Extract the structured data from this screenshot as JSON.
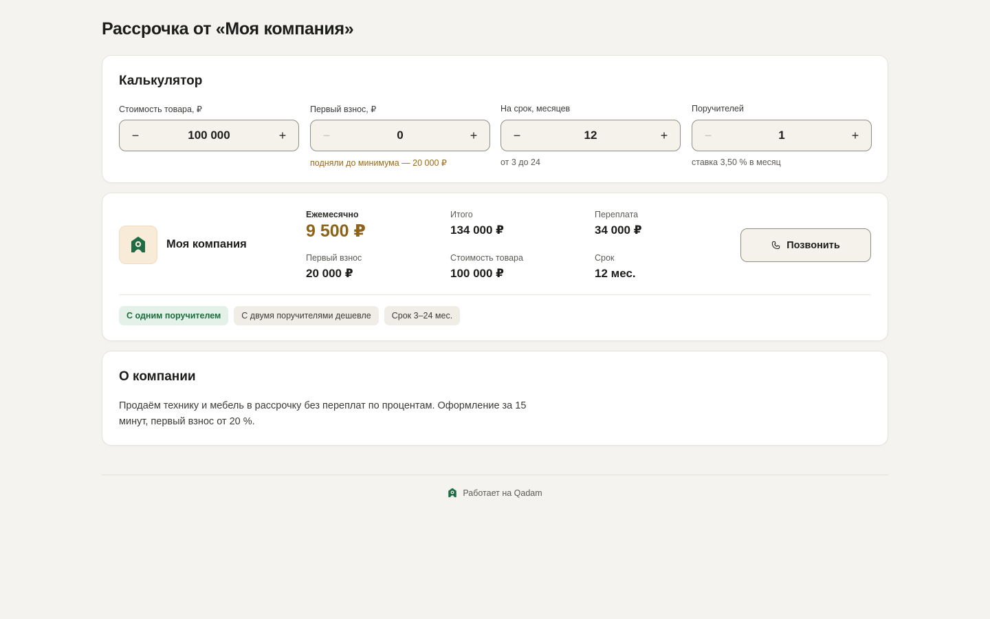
{
  "page": {
    "title": "Рассрочка от «Моя компания»"
  },
  "calculator": {
    "title": "Калькулятор",
    "fields": [
      {
        "label": "Стоимость товара, ₽",
        "value": "100 000",
        "hint": "",
        "minus_disabled": false
      },
      {
        "label": "Первый взнос, ₽",
        "value": "0",
        "hint": "подняли до минимума — 20 000 ₽",
        "minus_disabled": true
      },
      {
        "label": "На срок, месяцев",
        "value": "12",
        "hint": "от 3 до 24",
        "minus_disabled": false
      },
      {
        "label": "Поручителей",
        "value": "1",
        "hint": "ставка 3,50 % в месяц",
        "minus_disabled": true
      }
    ],
    "minus_symbol": "−",
    "plus_symbol": "+"
  },
  "offer": {
    "company_name": "Моя компания",
    "logo_icon": "house-shield-icon",
    "monthly": {
      "label": "Ежемесячно",
      "value": "9 500 ₽"
    },
    "total": {
      "label": "Итого",
      "value": "134 000 ₽"
    },
    "overpay": {
      "label": "Переплата",
      "value": "34 000 ₽"
    },
    "down_payment": {
      "label": "Первый взнос",
      "value": "20 000 ₽"
    },
    "price": {
      "label": "Стоимость товара",
      "value": "100 000 ₽"
    },
    "term": {
      "label": "Срок",
      "value": "12 мес."
    },
    "call_button": "Позвонить",
    "chips": [
      {
        "label": "С одним поручителем",
        "active": true
      },
      {
        "label": "С двумя поручителями дешевле",
        "active": false
      },
      {
        "label": "Срок 3–24 мес.",
        "active": false
      }
    ]
  },
  "about": {
    "title": "О компании",
    "text": "Продаём технику и мебель в рассрочку без переплат по процентам. Оформление за 15 минут, первый взнос от 20 %."
  },
  "footer": {
    "text": "Работает на Qadam"
  },
  "colors": {
    "background": "#f4f3ef",
    "accent_gold": "#8d6219",
    "warn": "#9a6a12",
    "brand_green": "#1f6b45",
    "chip_green_bg": "#e3f1e8"
  }
}
